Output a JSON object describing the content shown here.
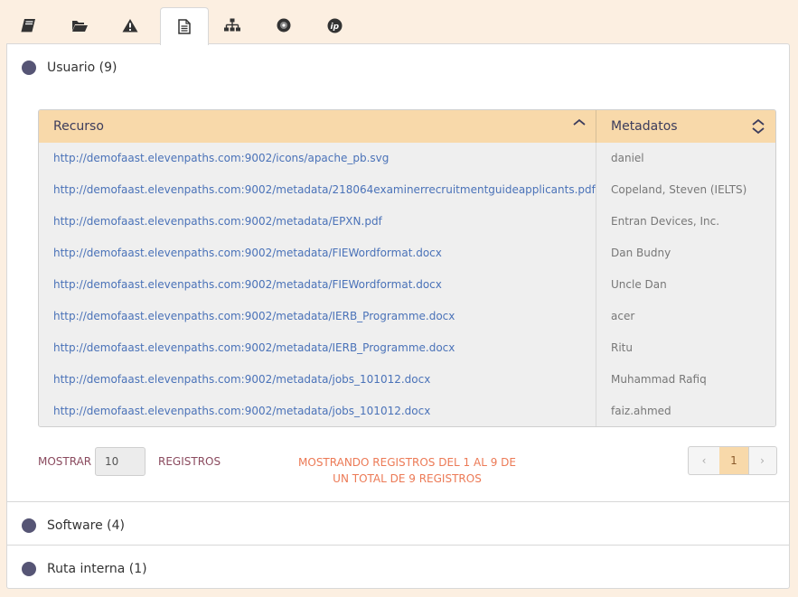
{
  "tabs": [
    {
      "icon": "book-icon"
    },
    {
      "icon": "folder-open-icon"
    },
    {
      "icon": "warning-icon"
    },
    {
      "icon": "document-icon"
    },
    {
      "icon": "sitemap-icon"
    },
    {
      "icon": "disc-icon"
    },
    {
      "icon": "ip-icon"
    }
  ],
  "active_tab_index": 3,
  "sections": {
    "usuario": {
      "title": "Usuario (9)"
    },
    "software": {
      "title": "Software (4)"
    },
    "ruta": {
      "title": "Ruta interna (1)"
    }
  },
  "table": {
    "headers": {
      "resource": "Recurso",
      "metadata": "Metadatos"
    },
    "rows": [
      {
        "url": "http://demofaast.elevenpaths.com:9002/icons/apache_pb.svg",
        "meta": "daniel"
      },
      {
        "url": "http://demofaast.elevenpaths.com:9002/metadata/218064examinerrecruitmentguideapplicants.pdf",
        "meta": "Copeland, Steven (IELTS)"
      },
      {
        "url": "http://demofaast.elevenpaths.com:9002/metadata/EPXN.pdf",
        "meta": "Entran Devices, Inc."
      },
      {
        "url": "http://demofaast.elevenpaths.com:9002/metadata/FIEWordformat.docx",
        "meta": "Dan Budny"
      },
      {
        "url": "http://demofaast.elevenpaths.com:9002/metadata/FIEWordformat.docx",
        "meta": "Uncle Dan"
      },
      {
        "url": "http://demofaast.elevenpaths.com:9002/metadata/IERB_Programme.docx",
        "meta": "acer"
      },
      {
        "url": "http://demofaast.elevenpaths.com:9002/metadata/IERB_Programme.docx",
        "meta": "Ritu"
      },
      {
        "url": "http://demofaast.elevenpaths.com:9002/metadata/jobs_101012.docx",
        "meta": "Muhammad Rafiq"
      },
      {
        "url": "http://demofaast.elevenpaths.com:9002/metadata/jobs_101012.docx",
        "meta": "faiz.ahmed"
      }
    ]
  },
  "footer": {
    "show_label": "MOSTRAR",
    "page_size": "10",
    "records_label": "REGISTROS",
    "info_line1": "MOSTRANDO REGISTROS DEL 1 AL 9 DE",
    "info_line2": "UN TOTAL DE 9 REGISTROS",
    "pager": {
      "prev": "‹",
      "current": "1",
      "next": "›"
    }
  },
  "colors": {
    "background": "#fcefe1",
    "header": "#f8d9aa",
    "link": "#4a72b8",
    "info": "#ec7a56",
    "dot": "#565575"
  }
}
